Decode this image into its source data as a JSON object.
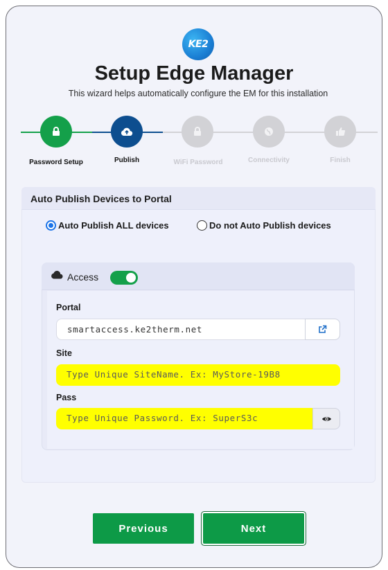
{
  "app": {
    "logo_text": "KE2",
    "title": "Setup Edge Manager",
    "subtitle": "This wizard helps automatically configure the EM for this installation"
  },
  "steps": [
    {
      "label": "Password Setup",
      "state": "done",
      "icon": "lock-icon"
    },
    {
      "label": "Publish",
      "state": "active",
      "icon": "cloud-upload-icon"
    },
    {
      "label": "WiFi Password",
      "state": "pending",
      "icon": "lock-icon"
    },
    {
      "label": "Connectivity",
      "state": "pending",
      "icon": "globe-icon"
    },
    {
      "label": "Finish",
      "state": "pending",
      "icon": "thumbs-up-icon"
    }
  ],
  "panel": {
    "title": "Auto Publish Devices to Portal",
    "options": [
      {
        "label": "Auto Publish ALL devices",
        "checked": true
      },
      {
        "label": "Do not Auto Publish devices",
        "checked": false
      }
    ]
  },
  "access": {
    "label": "Access",
    "enabled": true,
    "portal": {
      "label": "Portal",
      "value": "smartaccess.ke2therm.net"
    },
    "site": {
      "label": "Site",
      "placeholder": "Type Unique SiteName. Ex: MyStore-19B8"
    },
    "pass": {
      "label": "Pass",
      "placeholder": "Type Unique Password. Ex: SuperS3c"
    }
  },
  "buttons": {
    "previous": "Previous",
    "next": "Next"
  },
  "colors": {
    "success": "#14a04a",
    "active_step": "#0d4e8f",
    "pending_step": "#d2d2d6",
    "highlight": "#ffff00",
    "button": "#0d9a47"
  }
}
